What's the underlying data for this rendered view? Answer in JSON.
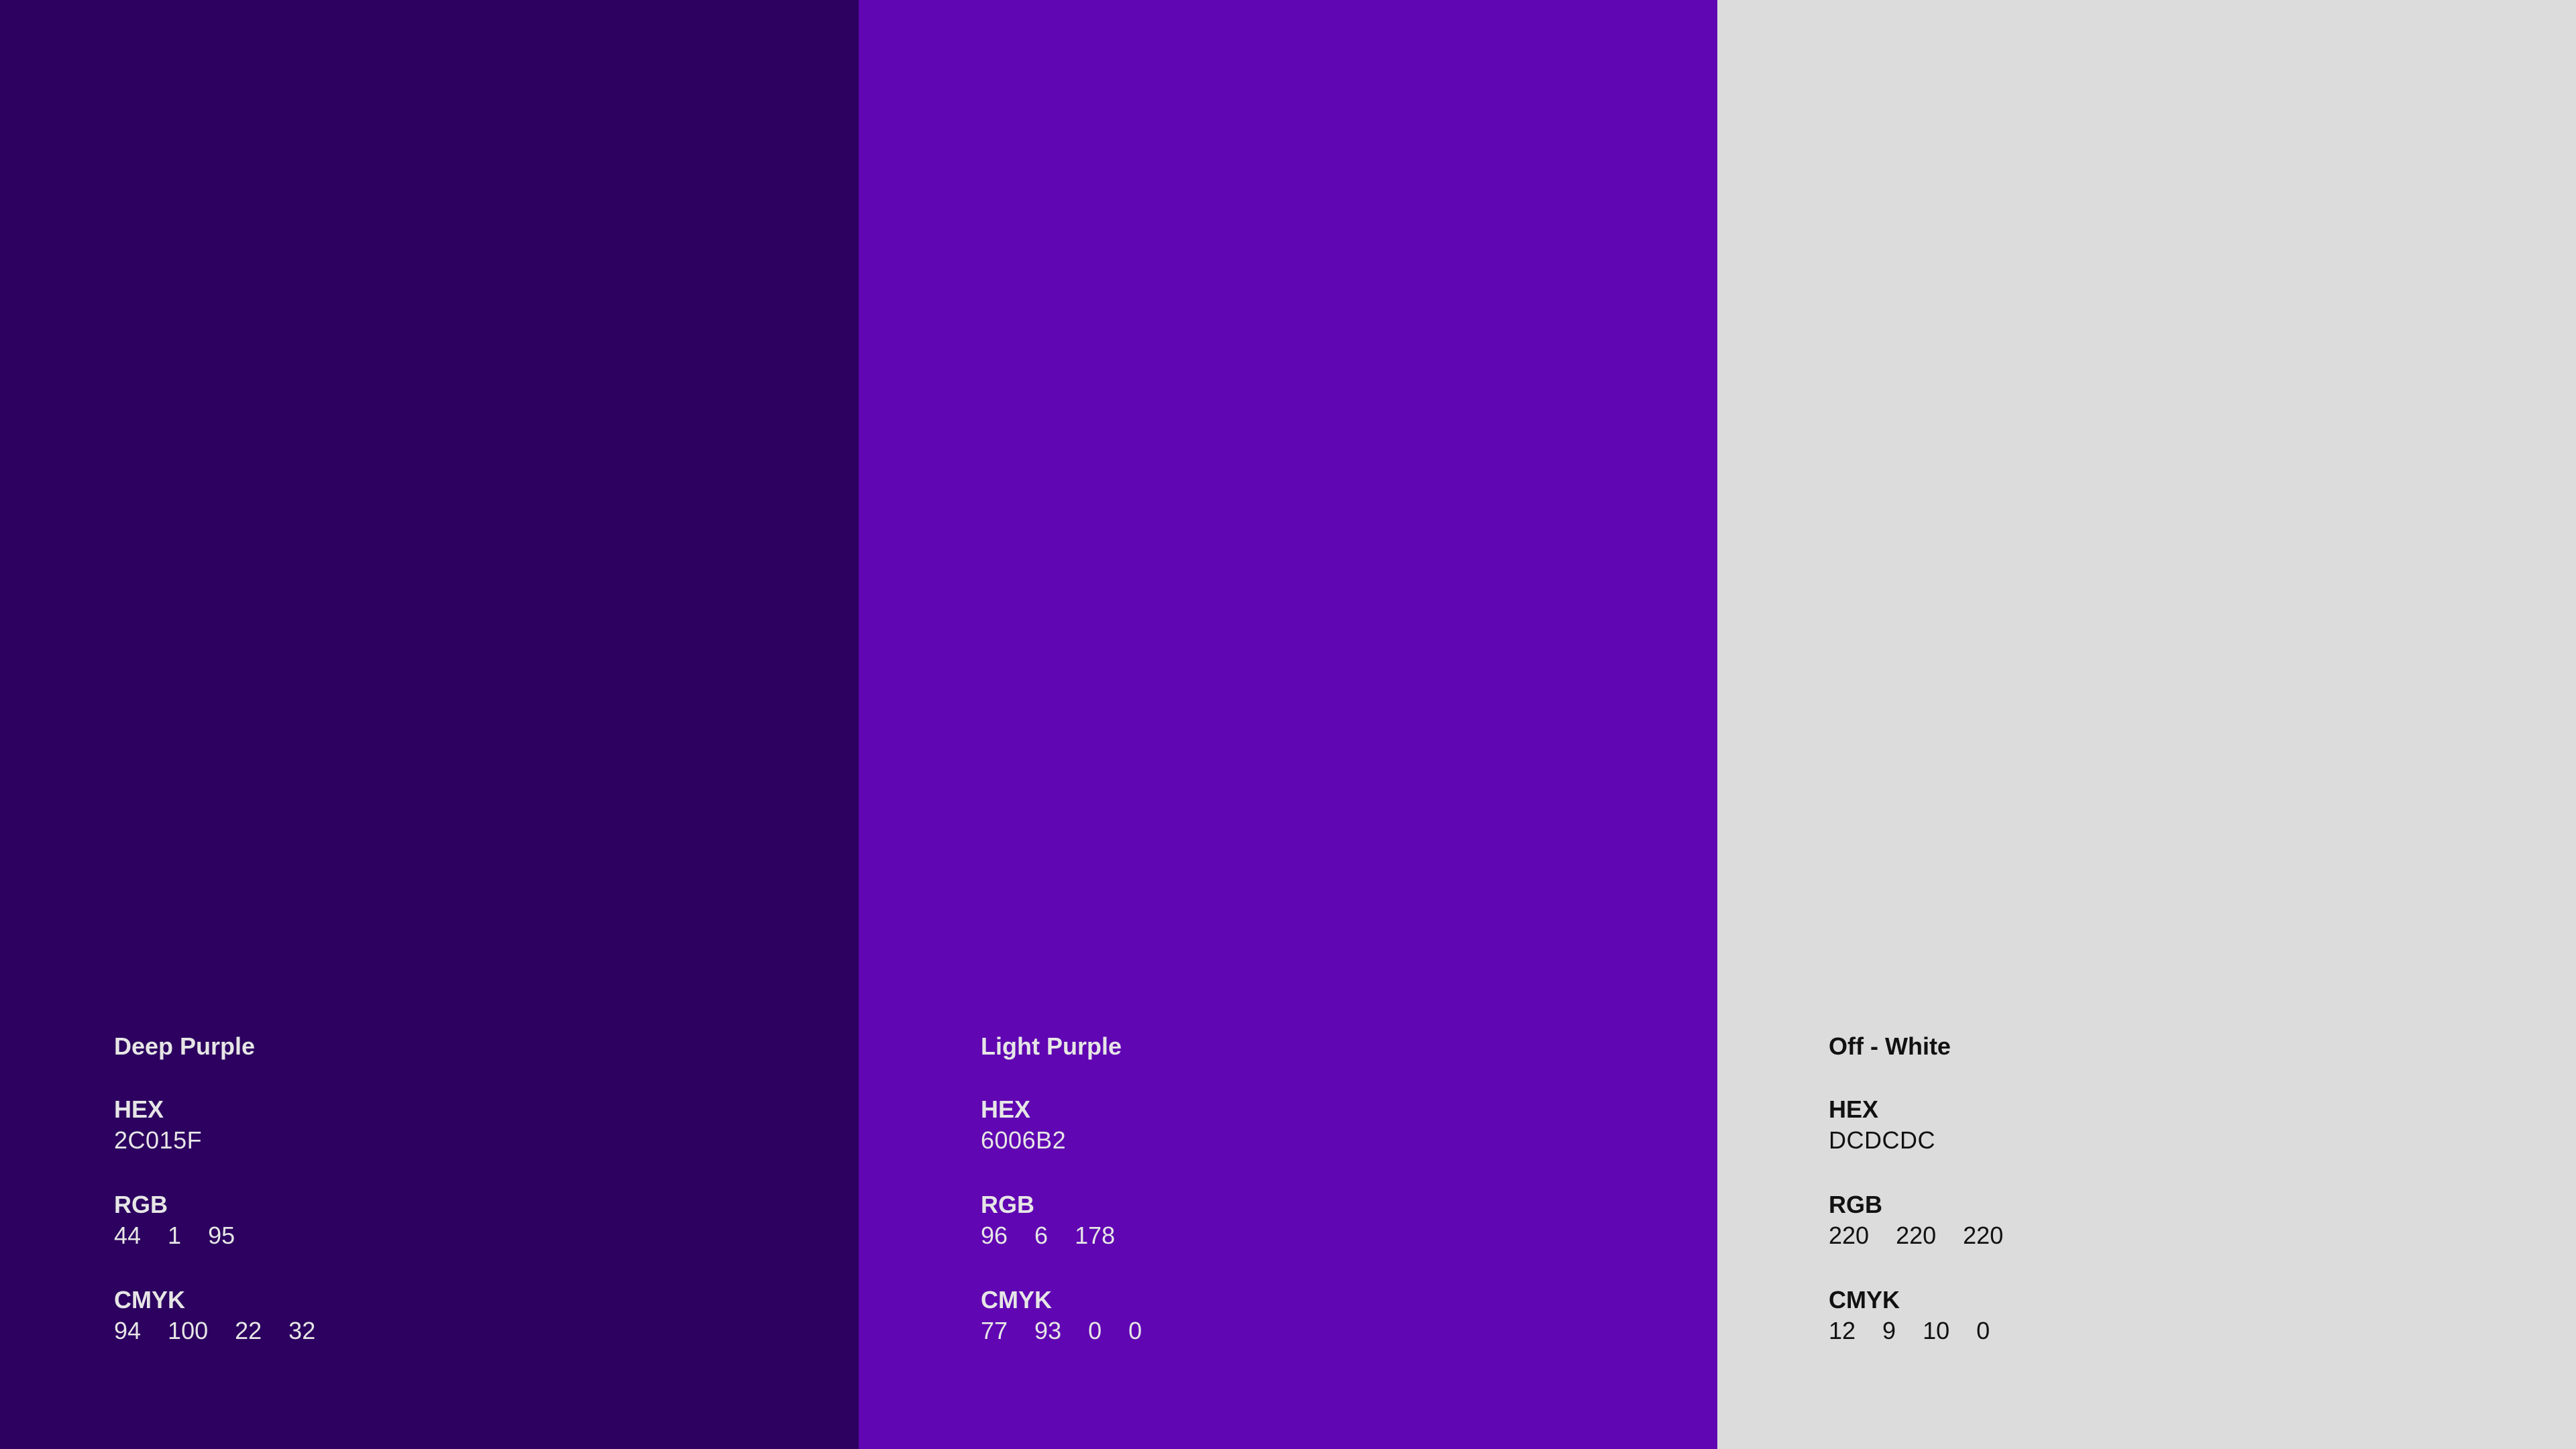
{
  "swatches": [
    {
      "name": "Deep Purple",
      "background": "#2C015F",
      "text_color": "#E6E6E6",
      "hex_label": "HEX",
      "hex": "2C015F",
      "rgb_label": "RGB",
      "rgb": [
        "44",
        "1",
        "95"
      ],
      "cmyk_label": "CMYK",
      "cmyk": [
        "94",
        "100",
        "22",
        "32"
      ]
    },
    {
      "name": "Light Purple",
      "background": "#6006B2",
      "text_color": "#E6E6E6",
      "hex_label": "HEX",
      "hex": "6006B2",
      "rgb_label": "RGB",
      "rgb": [
        "96",
        "6",
        "178"
      ],
      "cmyk_label": "CMYK",
      "cmyk": [
        "77",
        "93",
        "0",
        "0"
      ]
    },
    {
      "name": "Off - White",
      "background": "#DCDCDC",
      "text_color": "#111111",
      "hex_label": "HEX",
      "hex": "DCDCDC",
      "rgb_label": "RGB",
      "rgb": [
        "220",
        "220",
        "220"
      ],
      "cmyk_label": "CMYK",
      "cmyk": [
        "12",
        "9",
        "10",
        "0"
      ]
    }
  ]
}
